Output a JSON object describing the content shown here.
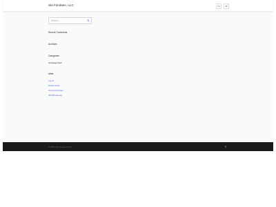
{
  "site": {
    "title": "Sia Fondsen, LLC"
  },
  "header": {
    "search_icon": "search-icon",
    "menu_icon": "menu-icon"
  },
  "search": {
    "placeholder": "Search …",
    "submit_icon": "search-icon"
  },
  "widgets": {
    "recent_comments": {
      "title": "Recent Comments"
    },
    "archives": {
      "title": "Archives"
    },
    "categories": {
      "title": "Categories",
      "items": [
        "Uncategorized"
      ]
    },
    "meta": {
      "title": "Meta",
      "links": [
        "Log in",
        "Entries feed",
        "Comments feed",
        "WordPress.org"
      ]
    }
  },
  "footer": {
    "copyright": "© 2024 Sia Fondsen, LLC",
    "to_top_icon": "arrow-up-icon"
  },
  "colors": {
    "link": "#3b5bdb",
    "footer_bg": "#1a1a1a",
    "page_bg": "#fafafa"
  }
}
